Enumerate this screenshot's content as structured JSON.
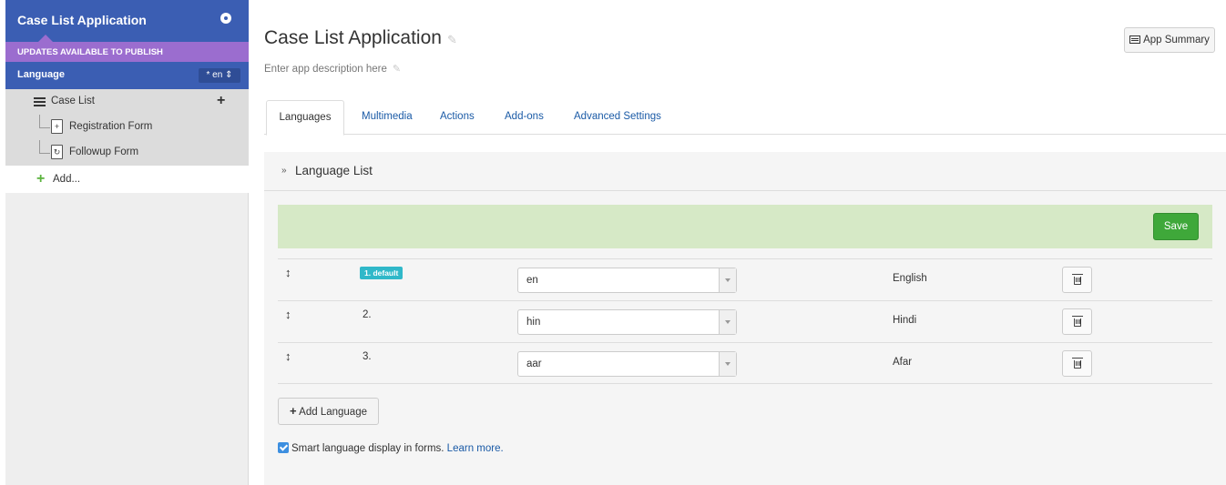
{
  "sidebar": {
    "app_title": "Case List Application",
    "updates_banner": "UPDATES AVAILABLE TO PUBLISH",
    "language_label": "Language",
    "language_picker": "* en ⇕",
    "module_label": "Case List",
    "forms": [
      {
        "label": "Registration Form",
        "icon": "+"
      },
      {
        "label": "Followup Form",
        "icon": "↻"
      }
    ],
    "add_label": "Add..."
  },
  "header": {
    "title": "Case List Application",
    "description": "Enter app description here",
    "summary_button": "App Summary"
  },
  "tabs": [
    {
      "label": "Languages",
      "active": true
    },
    {
      "label": "Multimedia",
      "active": false
    },
    {
      "label": "Actions",
      "active": false
    },
    {
      "label": "Add-ons",
      "active": false
    },
    {
      "label": "Advanced Settings",
      "active": false
    }
  ],
  "panel": {
    "title": "Language List",
    "save_label": "Save",
    "languages": [
      {
        "order": "1. default",
        "code": "en",
        "name": "English"
      },
      {
        "order": "2.",
        "code": "hin",
        "name": "Hindi"
      },
      {
        "order": "3.",
        "code": "aar",
        "name": "Afar"
      }
    ],
    "add_language_label": "Add Language",
    "smart_display_text": "Smart language display in forms.",
    "learn_more": "Learn more."
  },
  "colors": {
    "sidebar_header": "#3b5eb3",
    "updates_banner": "#9b6dcf",
    "save_button": "#3fa83a",
    "save_bar": "#d6e9c6",
    "default_badge": "#30b8c9",
    "link": "#1a5aa6"
  }
}
